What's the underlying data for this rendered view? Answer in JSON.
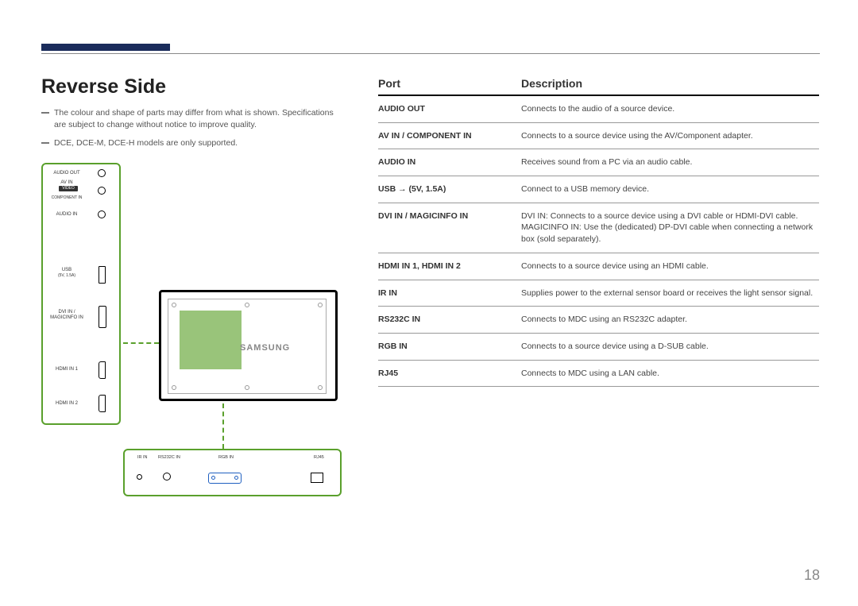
{
  "heading": "Reverse Side",
  "notes": [
    "The colour and shape of parts may differ from what is shown. Specifications are subject to change without notice to improve quality.",
    "DCE, DCE-M, DCE-H models are only supported."
  ],
  "table": {
    "port_header": "Port",
    "desc_header": "Description",
    "rows": [
      {
        "port": "AUDIO OUT",
        "desc": "Connects to the audio of a source device."
      },
      {
        "port": "AV IN / COMPONENT IN",
        "desc": "Connects to a source device using the AV/Component adapter."
      },
      {
        "port": "AUDIO IN",
        "desc": "Receives sound from a PC via an audio cable."
      },
      {
        "port": "USB → (5V, 1.5A)",
        "desc": "Connect to a USB memory device."
      },
      {
        "port": "DVI IN / MAGICINFO IN",
        "desc": "DVI IN: Connects to a source device using a DVI cable or HDMI-DVI cable.\nMAGICINFO IN: Use the (dedicated) DP-DVI cable when connecting a network box (sold separately)."
      },
      {
        "port": "HDMI IN 1, HDMI IN 2",
        "desc": "Connects to a source device using an HDMI cable."
      },
      {
        "port": "IR IN",
        "desc": "Supplies power to the external sensor board or receives the light sensor signal."
      },
      {
        "port": "RS232C IN",
        "desc": "Connects to MDC using an RS232C adapter."
      },
      {
        "port": "RGB IN",
        "desc": "Connects to a source device using a D-SUB cable."
      },
      {
        "port": "RJ45",
        "desc": "Connects to MDC using a LAN cable."
      }
    ]
  },
  "side_labels": {
    "audio_out": "AUDIO OUT",
    "av_in": "AV IN",
    "video": "VIDEO",
    "component_in": "COMPONENT IN",
    "audio_in": "AUDIO IN",
    "usb": "USB",
    "usb_spec": "(5V, 1.5A)",
    "dvi": "DVI IN / MAGICINFO IN",
    "hdmi1": "HDMI IN 1",
    "hdmi2": "HDMI IN 2"
  },
  "bottom_labels": {
    "ir_in": "IR IN",
    "rs232c": "RS232C IN",
    "rgb_in": "RGB IN",
    "rj45": "RJ45"
  },
  "brand": "SAMSUNG",
  "page_number": "18"
}
